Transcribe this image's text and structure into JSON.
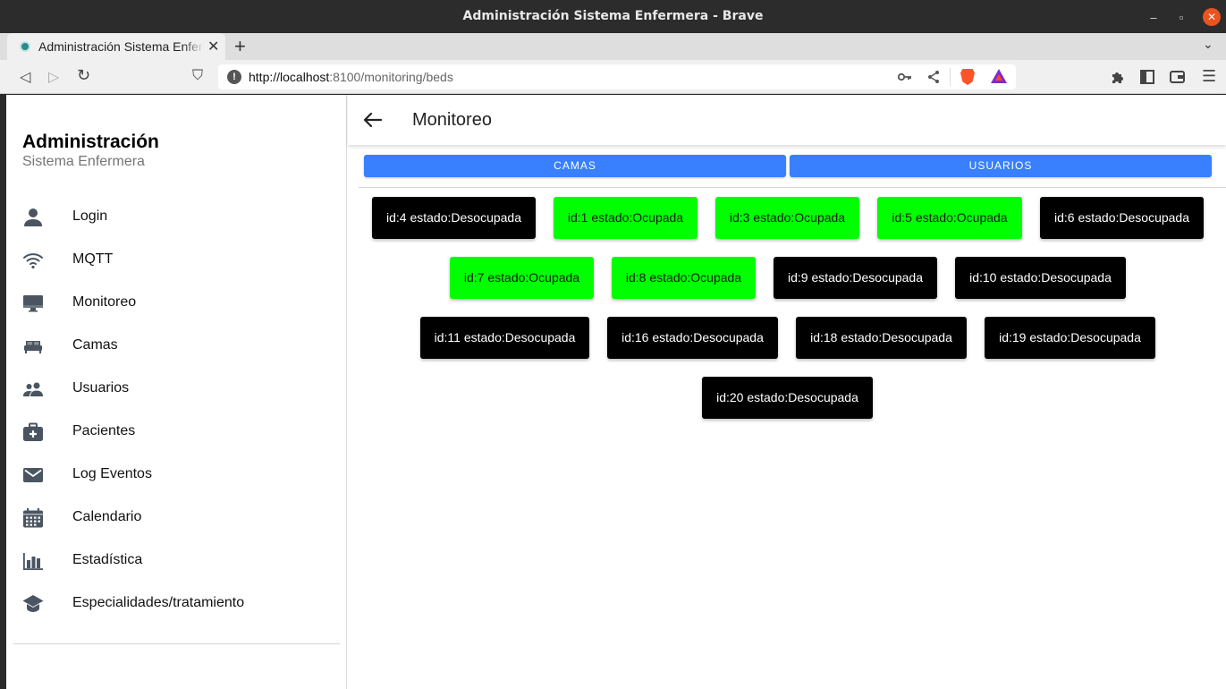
{
  "window": {
    "title": "Administración Sistema Enfermera - Brave",
    "minimize": "–",
    "maximize": "▫",
    "close": "✕"
  },
  "tabs": [
    {
      "title": "Administración Sistema Enfermera",
      "close": "✕"
    }
  ],
  "new_tab": "+",
  "tab_menu": "⌄",
  "toolbar": {
    "back": "◁",
    "forward": "▷",
    "reload": "↻",
    "bookmark": "⛉",
    "url_host": "http://localhost",
    "url_rest": ":8100/monitoring/beds",
    "info": "!"
  },
  "sidebar": {
    "title": "Administración",
    "subtitle": "Sistema Enfermera",
    "items": [
      {
        "label": "Login",
        "icon": "person-icon"
      },
      {
        "label": "MQTT",
        "icon": "wifi-icon"
      },
      {
        "label": "Monitoreo",
        "icon": "desktop-icon"
      },
      {
        "label": "Camas",
        "icon": "bed-icon"
      },
      {
        "label": "Usuarios",
        "icon": "people-icon"
      },
      {
        "label": "Pacientes",
        "icon": "medkit-icon"
      },
      {
        "label": "Log Eventos",
        "icon": "mail-icon"
      },
      {
        "label": "Calendario",
        "icon": "calendar-icon"
      },
      {
        "label": "Estadística",
        "icon": "stats-chart-icon"
      },
      {
        "label": "Especialidades/tratamiento",
        "icon": "school-icon"
      }
    ]
  },
  "header": {
    "title": "Monitoreo"
  },
  "segments": [
    "CAMAS",
    "USUARIOS"
  ],
  "beds": [
    {
      "label": "id:4 estado:Desocupada",
      "state": "Desocupada"
    },
    {
      "label": "id:1 estado:Ocupada",
      "state": "Ocupada"
    },
    {
      "label": "id:3 estado:Ocupada",
      "state": "Ocupada"
    },
    {
      "label": "id:5 estado:Ocupada",
      "state": "Ocupada"
    },
    {
      "label": "id:6 estado:Desocupada",
      "state": "Desocupada"
    },
    {
      "label": "id:7 estado:Ocupada",
      "state": "Ocupada"
    },
    {
      "label": "id:8 estado:Ocupada",
      "state": "Ocupada"
    },
    {
      "label": "id:9 estado:Desocupada",
      "state": "Desocupada"
    },
    {
      "label": "id:10 estado:Desocupada",
      "state": "Desocupada"
    },
    {
      "label": "id:11 estado:Desocupada",
      "state": "Desocupada"
    },
    {
      "label": "id:16 estado:Desocupada",
      "state": "Desocupada"
    },
    {
      "label": "id:18 estado:Desocupada",
      "state": "Desocupada"
    },
    {
      "label": "id:19 estado:Desocupada",
      "state": "Desocupada"
    },
    {
      "label": "id:20 estado:Desocupada",
      "state": "Desocupada"
    }
  ],
  "colors": {
    "occupied": "#00ff00",
    "free": "#000000",
    "accent": "#3880ff",
    "icon": "#4a5561"
  }
}
